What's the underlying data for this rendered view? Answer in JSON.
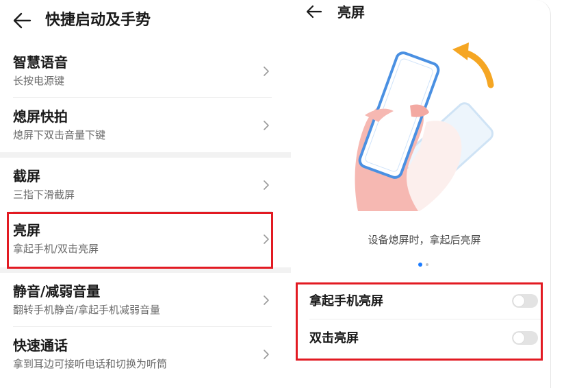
{
  "left": {
    "title": "快捷启动及手势",
    "items": [
      {
        "title": "智慧语音",
        "subtitle": "长按电源键"
      },
      {
        "title": "熄屏快拍",
        "subtitle": "熄屏下双击音量下键"
      },
      {
        "title": "截屏",
        "subtitle": "三指下滑截屏"
      },
      {
        "title": "亮屏",
        "subtitle": "拿起手机/双击亮屏"
      },
      {
        "title": "静音/减弱音量",
        "subtitle": "翻转手机静音/拿起手机减弱音量"
      },
      {
        "title": "快速通话",
        "subtitle": "拿到耳边可接听电话和切换为听筒"
      }
    ]
  },
  "right": {
    "title": "亮屏",
    "caption": "设备熄屏时，拿起后亮屏",
    "page_indicator": {
      "current": 1,
      "total": 2
    },
    "toggles": [
      {
        "label": "拿起手机亮屏",
        "on": false
      },
      {
        "label": "双击亮屏",
        "on": false
      }
    ]
  },
  "colors": {
    "highlight": "#e21a22",
    "accent": "#1c7cff",
    "arrow": "#f5a623"
  },
  "icons": [
    "back-arrow-icon",
    "chevron-right-icon",
    "raise-to-wake-illustration"
  ]
}
